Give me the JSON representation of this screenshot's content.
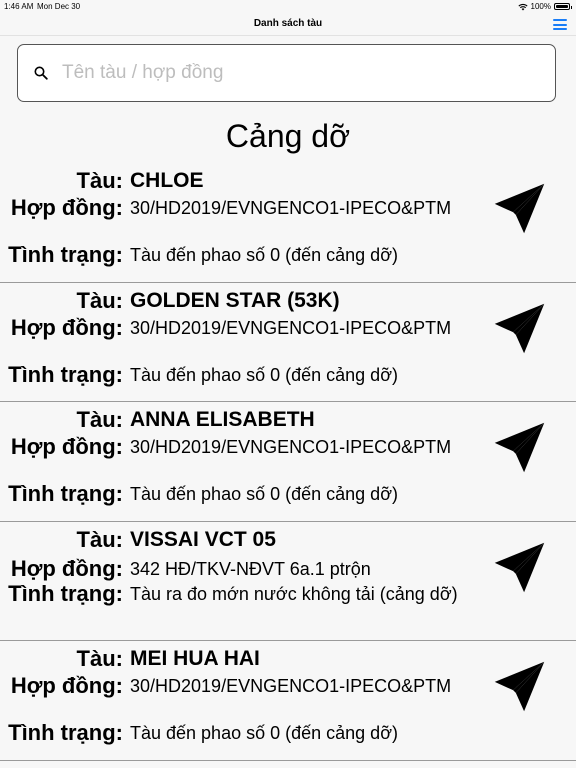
{
  "status_bar": {
    "time": "1:46 AM",
    "date": "Mon Dec 30",
    "battery": "100%"
  },
  "nav": {
    "title": "Danh sách tàu",
    "menu_icon": "hamburger-menu-icon"
  },
  "search": {
    "placeholder": "Tên tàu / hợp đồng",
    "value": ""
  },
  "section_title": "Cảng dỡ",
  "labels": {
    "ship": "Tàu:",
    "contract": "Hợp đồng:",
    "status": "Tình trạng:"
  },
  "ships": [
    {
      "name": "CHLOE",
      "contract": "30/HD2019/EVNGENCO1-IPECO&PTM",
      "status": "Tàu đến phao số 0 (đến cảng dỡ)"
    },
    {
      "name": "GOLDEN STAR (53K)",
      "contract": "30/HD2019/EVNGENCO1-IPECO&PTM",
      "status": "Tàu đến phao số 0 (đến cảng dỡ)"
    },
    {
      "name": "ANNA ELISABETH",
      "contract": "30/HD2019/EVNGENCO1-IPECO&PTM",
      "status": "Tàu đến phao số 0 (đến cảng dỡ)"
    },
    {
      "name": "VISSAI VCT 05",
      "contract": "342 HĐ/TKV-NĐVT 6a.1 ptrộn",
      "status": "Tàu ra đo mớn nước không tải (cảng dỡ)"
    },
    {
      "name": "MEI HUA HAI",
      "contract": "30/HD2019/EVNGENCO1-IPECO&PTM",
      "status": "Tàu đến phao số 0 (đến cảng dỡ)"
    }
  ],
  "colors": {
    "accent": "#1a7ef7",
    "background": "#f7f7f7",
    "separator": "#9a9a9a"
  }
}
